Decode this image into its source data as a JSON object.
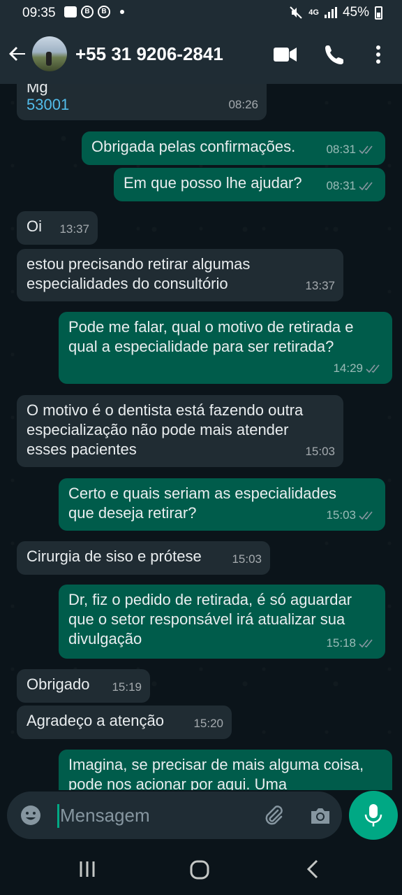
{
  "status_bar": {
    "time": "09:35",
    "network": "4G",
    "battery": "45%"
  },
  "header": {
    "contact_name": "+55 31 9206-2841"
  },
  "messages": [
    {
      "dir": "in",
      "text": "Mg",
      "link": "53001",
      "time": "08:26"
    },
    {
      "dir": "out",
      "text": "Obrigada pelas confirmações.",
      "time": "08:31"
    },
    {
      "dir": "out",
      "text": "Em que posso lhe ajudar?",
      "time": "08:31"
    },
    {
      "dir": "in",
      "text": "Oi",
      "time": "13:37"
    },
    {
      "dir": "in",
      "text": "estou precisando retirar algumas especialidades do consultório",
      "time": "13:37"
    },
    {
      "dir": "out",
      "text": "Pode me falar, qual o motivo de retirada e qual a especialidade para ser retirada?",
      "time": "14:29"
    },
    {
      "dir": "in",
      "text": "O motivo é o dentista está fazendo outra especialização não pode mais atender esses pacientes",
      "time": "15:03"
    },
    {
      "dir": "out",
      "text": "Certo e quais seriam as especialidades que deseja retirar?",
      "time": "15:03"
    },
    {
      "dir": "in",
      "text": "Cirurgia de siso e prótese",
      "time": "15:03"
    },
    {
      "dir": "out",
      "text": "Dr, fiz o pedido de retirada, é só aguardar que o setor responsável irá atualizar sua divulgação",
      "time": "15:18"
    },
    {
      "dir": "in",
      "text": "Obrigado",
      "time": "15:19"
    },
    {
      "dir": "in",
      "text": "Agradeço a atenção",
      "time": "15:20"
    },
    {
      "dir": "out",
      "text": "Imagina, se precisar de mais alguma coisa, pode nos acionar por aqui. Uma",
      "time": ""
    }
  ],
  "input": {
    "placeholder": "Mensagem"
  },
  "icons": {
    "header": [
      "back-arrow-icon",
      "avatar",
      "video-call-icon",
      "phone-icon",
      "more-vertical-icon"
    ],
    "input": [
      "emoji-icon",
      "attach-icon",
      "camera-icon",
      "mic-icon"
    ],
    "nav": [
      "recents-icon",
      "home-icon",
      "back-icon"
    ]
  },
  "colors": {
    "header": "#1f2c34",
    "incoming": "#202c33",
    "outgoing": "#005c4b",
    "accent": "#00a884",
    "link": "#53bdeb"
  }
}
